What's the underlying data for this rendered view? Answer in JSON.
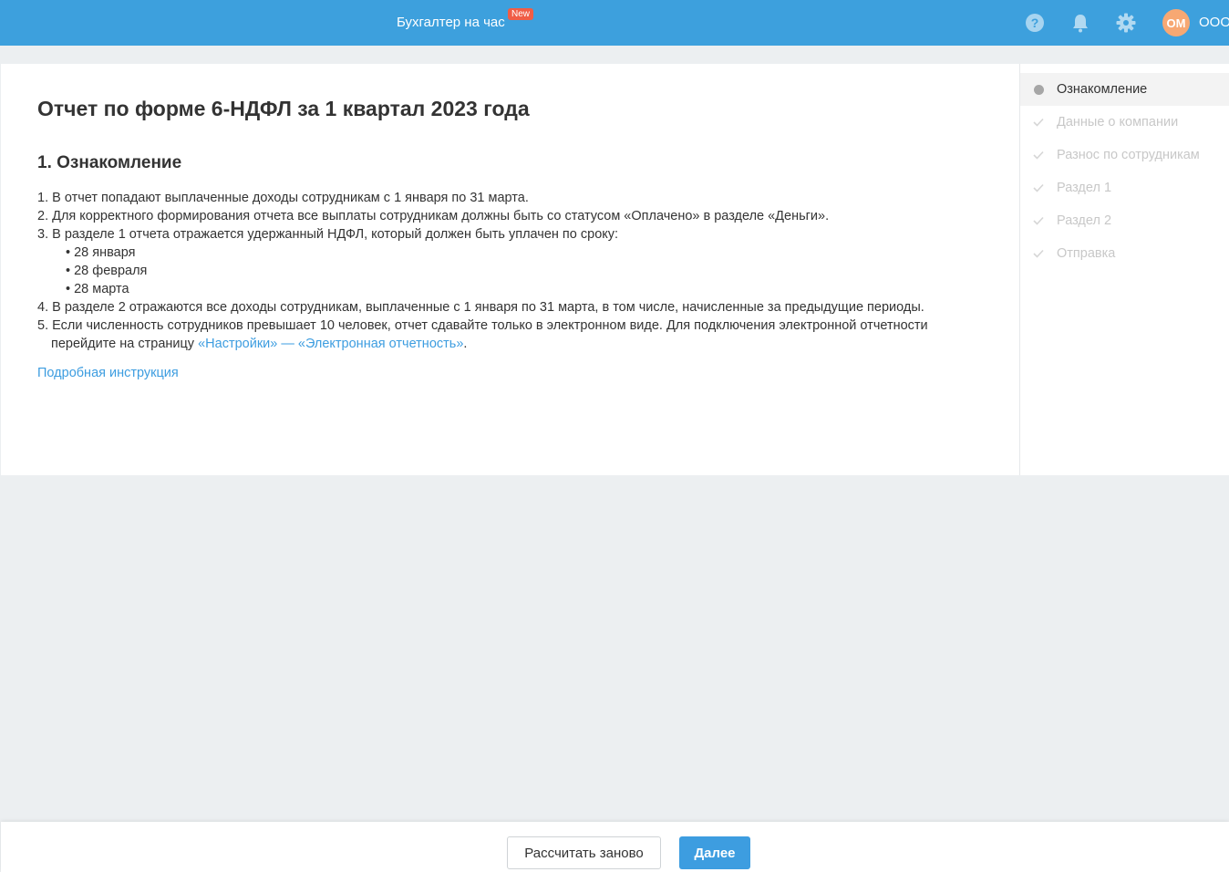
{
  "topbar": {
    "promo_label": "Бухгалтер на час",
    "new_badge": "New",
    "help_icon": "help-circle-icon",
    "notifications_icon": "bell-icon",
    "settings_icon": "gear-icon",
    "avatar_initials": "ОМ",
    "company_name": "ООО",
    "colors": {
      "bar": "#3da0dd",
      "avatar": "#f7a873",
      "badge": "#f05d46"
    }
  },
  "report": {
    "title": "Отчет по форме 6-НДФЛ за 1 квартал 2023 года",
    "section_title": "1. Ознакомление",
    "items": {
      "item1": "1. В отчет попадают выплаченные доходы сотрудникам с 1 января по 31 марта.",
      "item2": "2. Для корректного формирования отчета все выплаты сотрудникам должны быть со статусом «Оплачено» в разделе «Деньги».",
      "item3": "3. В разделе 1 отчета отражается удержанный НДФЛ, который должен быть уплачен по сроку:",
      "item3_bullets": [
        "• 28 января",
        "• 28 февраля",
        "• 28 марта"
      ],
      "item4": "4. В разделе 2 отражаются все доходы сотрудникам, выплаченные с 1 января по 31 марта, в том числе, начисленные за предыдущие периоды.",
      "item5_line1": "5. Если численность сотрудников превышает 10 человек, отчет сдавайте только в электронном виде. Для подключения электронной отчетности",
      "item5_line2_prefix": "перейдите на страницу ",
      "item5_link": "«Настройки» — «Электронная отчетность»",
      "item5_line2_suffix": "."
    },
    "instruction_link": "Подробная инструкция"
  },
  "stepper": {
    "steps": [
      {
        "label": "Ознакомление",
        "state": "active",
        "icon": "dot-icon"
      },
      {
        "label": "Данные о компании",
        "state": "pending",
        "icon": "check-icon"
      },
      {
        "label": "Разнос по сотрудникам",
        "state": "pending",
        "icon": "check-icon"
      },
      {
        "label": "Раздел 1",
        "state": "pending",
        "icon": "check-icon"
      },
      {
        "label": "Раздел 2",
        "state": "pending",
        "icon": "check-icon"
      },
      {
        "label": "Отправка",
        "state": "pending",
        "icon": "check-icon"
      }
    ]
  },
  "footer": {
    "recalculate_label": "Рассчитать заново",
    "next_label": "Далее",
    "accent_color": "#3d9de0"
  }
}
